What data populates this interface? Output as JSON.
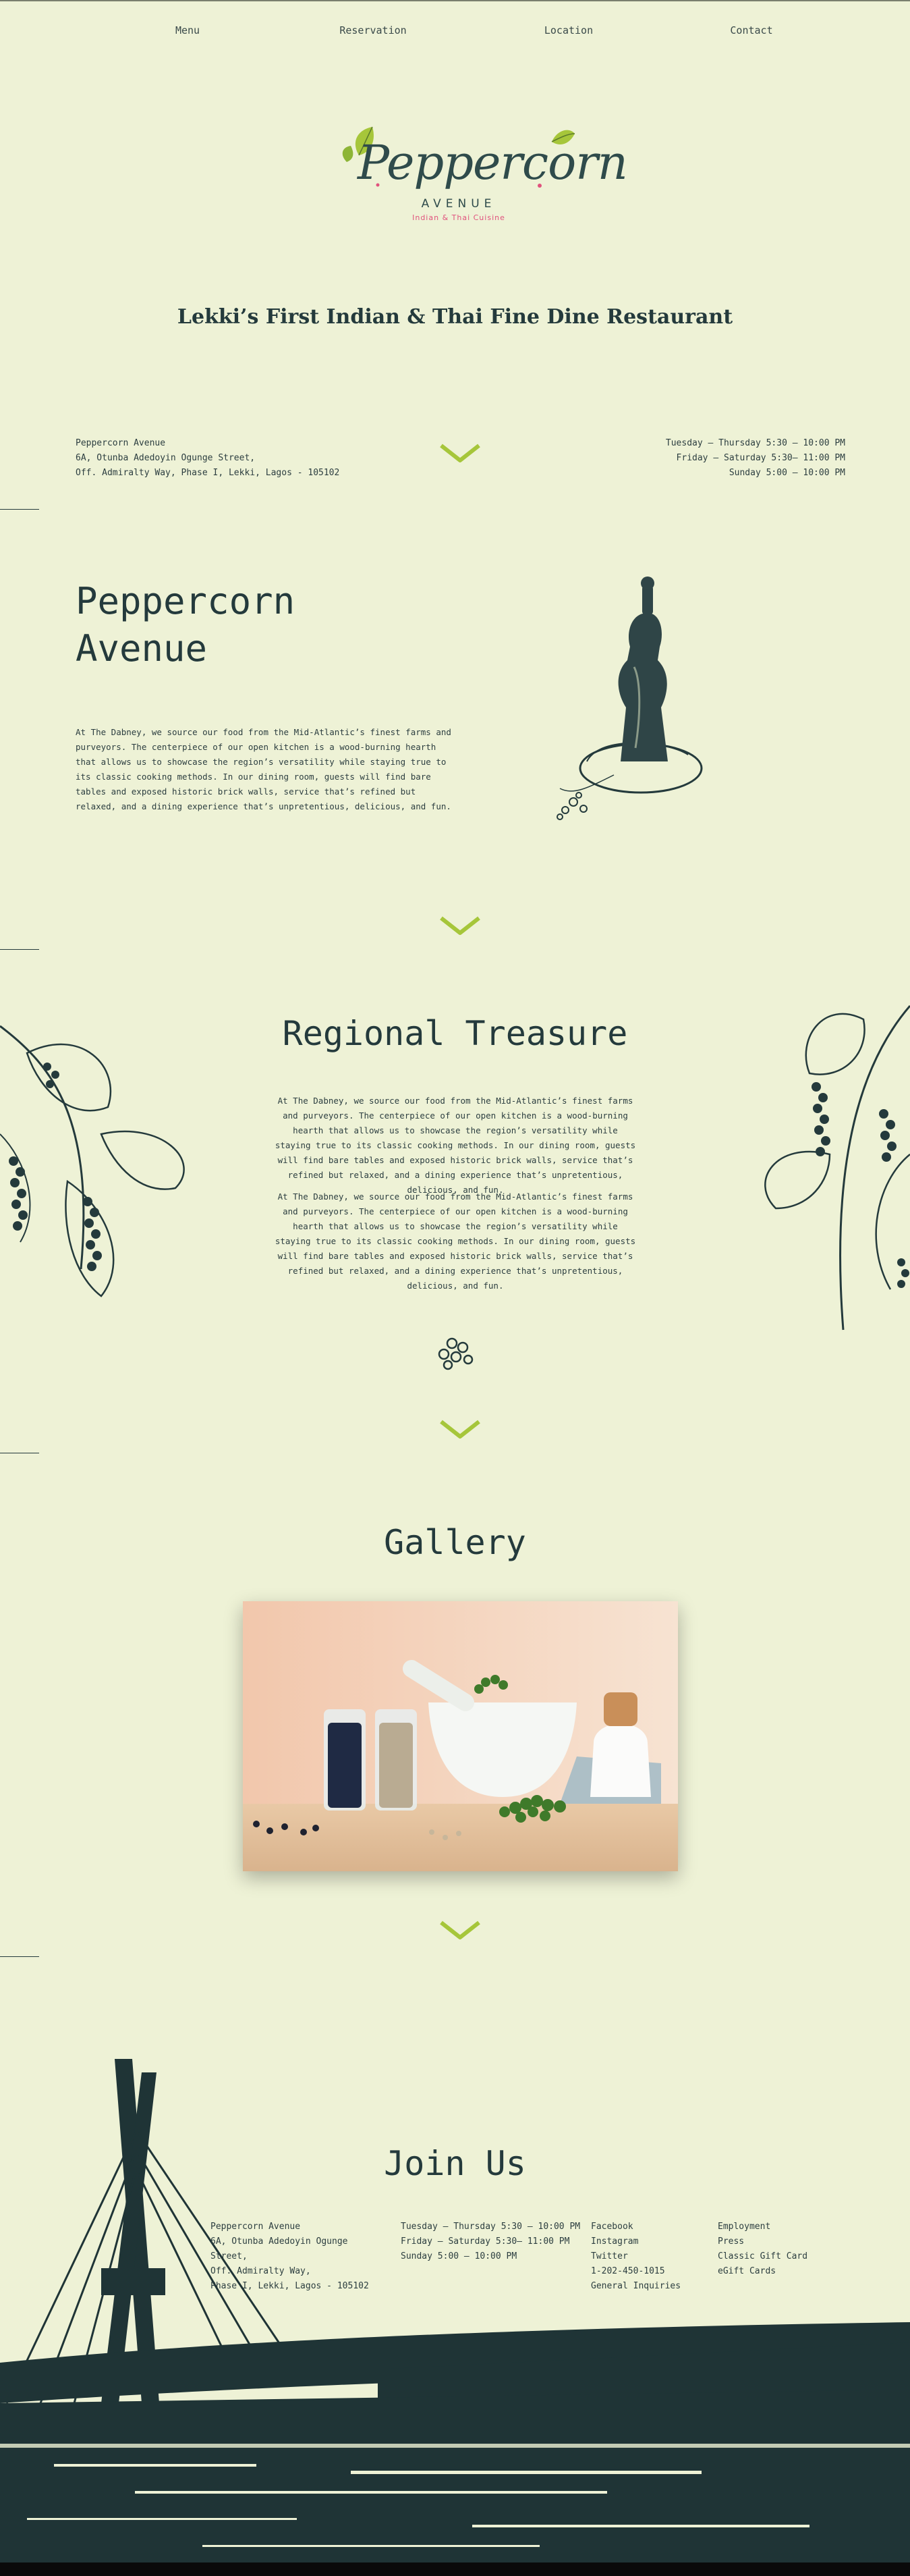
{
  "nav": {
    "items": [
      {
        "label": "Menu"
      },
      {
        "label": "Reservation"
      },
      {
        "label": "Location"
      },
      {
        "label": "Contact"
      }
    ]
  },
  "logo": {
    "name": "Peppercorn",
    "sub": "AVENUE",
    "tagline": "Indian & Thai Cuisine"
  },
  "hero": {
    "headline": "Lekki’s First Indian & Thai Fine Dine Restaurant"
  },
  "info": {
    "address": [
      "Peppercorn Avenue",
      "6A, Otunba Adedoyin Ogunge Street,",
      "Off. Admiralty Way, Phase I, Lekki, Lagos - 105102"
    ],
    "hours": [
      "Tuesday – Thursday 5:30 – 10:00 PM",
      "Friday – Saturday 5:30– 11:00 PM",
      "Sunday 5:00 – 10:00 PM"
    ]
  },
  "about": {
    "title_line1": "Peppercorn",
    "title_line2": "Avenue",
    "text": "At The Dabney, we source our food from the Mid-Atlantic’s finest farms and purveyors. The centerpiece of our open kitchen is a wood-burning hearth that allows us to showcase the region’s versatility while staying true to its classic cooking methods. In our dining room, guests will find bare tables and exposed historic brick walls, service that’s refined but relaxed, and a dining experience that’s unpretentious, delicious, and fun."
  },
  "regional": {
    "title": "Regional Treasure",
    "para1": "At The Dabney, we source our food from the Mid-Atlantic’s finest farms and purveyors. The centerpiece of our open kitchen is a wood-burning hearth that allows us to showcase the region’s versatility while staying true to its classic cooking methods. In our dining room, guests will find bare tables and exposed historic brick walls, service that’s refined but relaxed, and a dining experience that’s unpretentious, delicious, and fun.",
    "para2": "At The Dabney, we source our food from the Mid-Atlantic’s finest farms and purveyors. The centerpiece of our open kitchen is a wood-burning hearth that allows us to showcase the region’s versatility while staying true to its classic cooking methods. In our dining room, guests will find bare tables and exposed historic brick walls, service that’s refined but relaxed, and a dining experience that’s unpretentious, delicious, and fun."
  },
  "gallery": {
    "title": "Gallery"
  },
  "join": {
    "title": "Join Us",
    "address": [
      "Peppercorn Avenue",
      "6A, Otunba Adedoyin Ogunge",
      "Street,",
      "Off. Admiralty Way,",
      "Phase I, Lekki, Lagos - 105102"
    ],
    "hours": [
      "Tuesday – Thursday 5:30 – 10:00 PM",
      "Friday – Saturday 5:30– 11:00 PM",
      "Sunday 5:00 – 10:00 PM"
    ],
    "social": [
      "Facebook",
      "Instagram",
      "Twitter",
      "1-202-450-1015",
      "General Inquiries"
    ],
    "more": [
      "Employment",
      "Press",
      "Classic Gift Card",
      "eGift Cards"
    ]
  },
  "colors": {
    "background": "#eef2d6",
    "ink": "#243a3c",
    "accent_green": "#a6c63a",
    "logo_pink": "#e0527d"
  }
}
